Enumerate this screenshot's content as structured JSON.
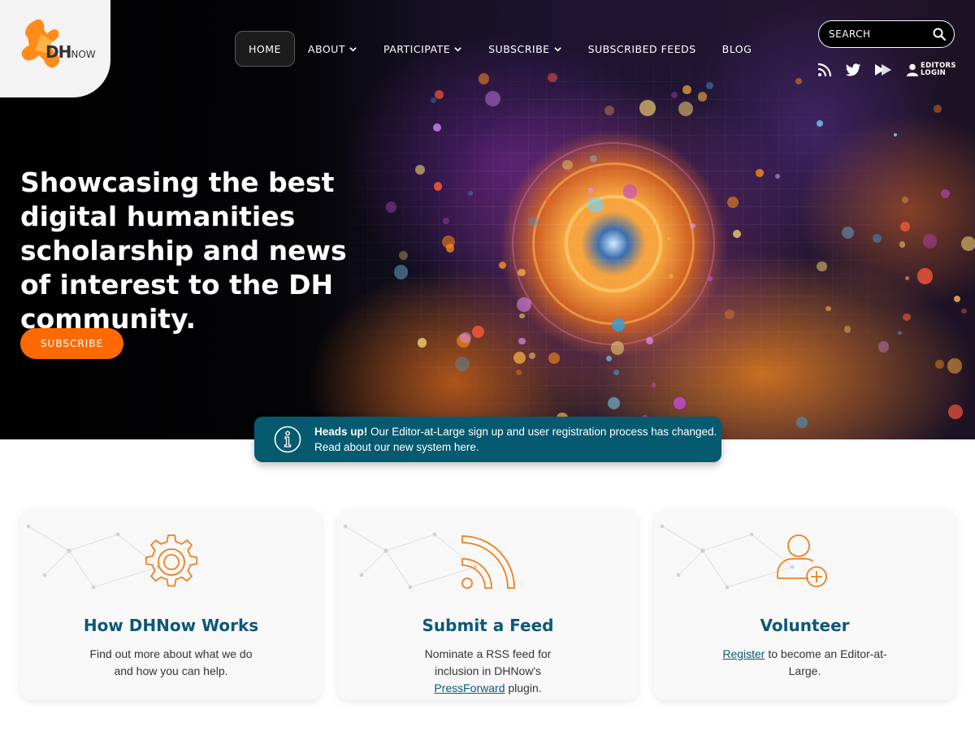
{
  "brand": {
    "logo_main": "DH",
    "logo_sub": "NOW",
    "accent_color": "#ff6a00",
    "teal_color": "#065a70"
  },
  "nav": {
    "items": [
      {
        "label": "HOME",
        "active": true,
        "dropdown": false
      },
      {
        "label": "ABOUT",
        "active": false,
        "dropdown": true
      },
      {
        "label": "PARTICIPATE",
        "active": false,
        "dropdown": true
      },
      {
        "label": "SUBSCRIBE",
        "active": false,
        "dropdown": true
      },
      {
        "label": "SUBSCRIBED FEEDS",
        "active": false,
        "dropdown": false
      },
      {
        "label": "BLOG",
        "active": false,
        "dropdown": false
      }
    ]
  },
  "search": {
    "placeholder": "SEARCH"
  },
  "social": {
    "icons": [
      "rss-icon",
      "twitter-icon",
      "play-icon",
      "user-icon"
    ],
    "editors_login": "EDITORS\nLOGIN"
  },
  "hero": {
    "headline": "Showcasing the best digital humanities scholarship and news of interest to the DH community.",
    "subscribe_label": "SUBSCRIBE"
  },
  "notice": {
    "icon": "info-icon",
    "bold": "Heads up!",
    "text": " Our Editor-at-Large sign up and user registration process has changed.",
    "text2": "Read about our new system here."
  },
  "cards": [
    {
      "icon": "gear-icon",
      "title": "How DHNow Works",
      "desc": "Find out more about what we do and how you can help."
    },
    {
      "icon": "rss-feed-icon",
      "title": "Submit a Feed",
      "desc_before": "Nominate a RSS feed for inclusion in DHNow's ",
      "link": "PressForward",
      "desc_after": " plugin."
    },
    {
      "icon": "add-user-icon",
      "title": "Volunteer",
      "link": "Register",
      "desc_after": " to become an Editor-at-Large."
    }
  ]
}
